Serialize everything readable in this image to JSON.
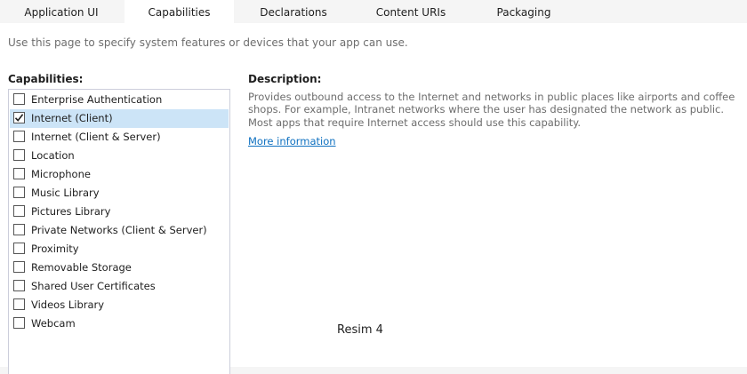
{
  "tabs": [
    {
      "label": "Application UI",
      "active": false
    },
    {
      "label": "Capabilities",
      "active": true
    },
    {
      "label": "Declarations",
      "active": false
    },
    {
      "label": "Content URIs",
      "active": false
    },
    {
      "label": "Packaging",
      "active": false
    }
  ],
  "intro_text": "Use this page to specify system features or devices that your app can use.",
  "capabilities_heading": "Capabilities:",
  "description_heading": "Description:",
  "capabilities": [
    {
      "label": "Enterprise Authentication",
      "checked": false,
      "selected": false
    },
    {
      "label": "Internet (Client)",
      "checked": true,
      "selected": true
    },
    {
      "label": "Internet (Client & Server)",
      "checked": false,
      "selected": false
    },
    {
      "label": "Location",
      "checked": false,
      "selected": false
    },
    {
      "label": "Microphone",
      "checked": false,
      "selected": false
    },
    {
      "label": "Music Library",
      "checked": false,
      "selected": false
    },
    {
      "label": "Pictures Library",
      "checked": false,
      "selected": false
    },
    {
      "label": "Private Networks (Client & Server)",
      "checked": false,
      "selected": false
    },
    {
      "label": "Proximity",
      "checked": false,
      "selected": false
    },
    {
      "label": "Removable Storage",
      "checked": false,
      "selected": false
    },
    {
      "label": "Shared User Certificates",
      "checked": false,
      "selected": false
    },
    {
      "label": "Videos Library",
      "checked": false,
      "selected": false
    },
    {
      "label": "Webcam",
      "checked": false,
      "selected": false
    }
  ],
  "description": "Provides outbound access to the Internet and networks in public places like airports and coffee shops. For example, Intranet networks where the user has designated the network as public. Most apps that require Internet access should use this capability.",
  "more_info_link": "More information",
  "caption": "Resim 4",
  "icons": {
    "checkbox_check": "check-icon"
  },
  "colors": {
    "selection": "#cce4f7",
    "link": "#0e70c0",
    "secondary_text": "#6d6d6d"
  }
}
